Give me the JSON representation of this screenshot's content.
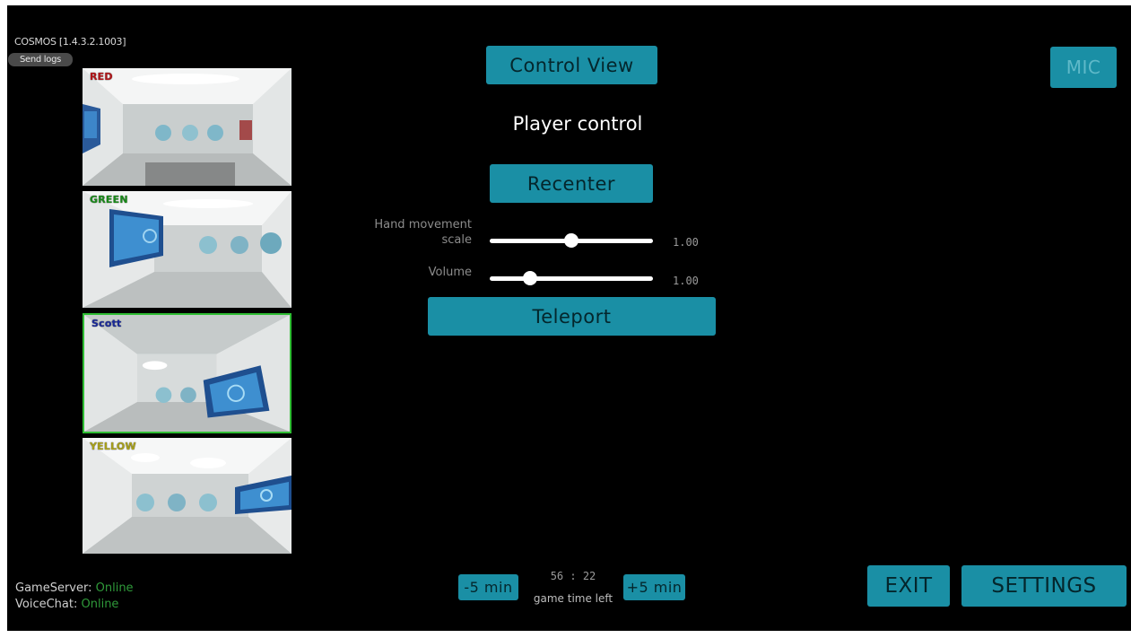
{
  "app": {
    "version": "COSMOS [1.4.3.2.1003]",
    "send_logs": "Send logs"
  },
  "cameras": [
    {
      "label": "RED",
      "color": "#b0161a",
      "selected": false
    },
    {
      "label": "GREEN",
      "color": "#1a8a1a",
      "selected": false
    },
    {
      "label": "Scott",
      "color": "#1a2a9a",
      "selected": true
    },
    {
      "label": "YELLOW",
      "color": "#a8a01a",
      "selected": false
    }
  ],
  "controls": {
    "control_view": "Control View",
    "section_title": "Player control",
    "recenter": "Recenter",
    "sliders": [
      {
        "label_line1": "Hand movement",
        "label_line2": "scale",
        "value_text": "1.00",
        "fraction": 0.5
      },
      {
        "label_line1": "Volume",
        "label_line2": "",
        "value_text": "1.00",
        "fraction": 0.22
      }
    ],
    "teleport": "Teleport"
  },
  "mic": "MIC",
  "status": {
    "gameserver_label": "GameServer: ",
    "gameserver_value": "Online",
    "voicechat_label": "VoiceChat: ",
    "voicechat_value": "Online"
  },
  "timer": {
    "minus": "-5 min",
    "plus": "+5 min",
    "time": "56 : 22",
    "label": "game time left"
  },
  "footer": {
    "exit": "EXIT",
    "settings": "SETTINGS"
  },
  "colors": {
    "accent": "#1a8fa5",
    "online": "#2f9a3a",
    "selected_border": "#2fbe34"
  }
}
